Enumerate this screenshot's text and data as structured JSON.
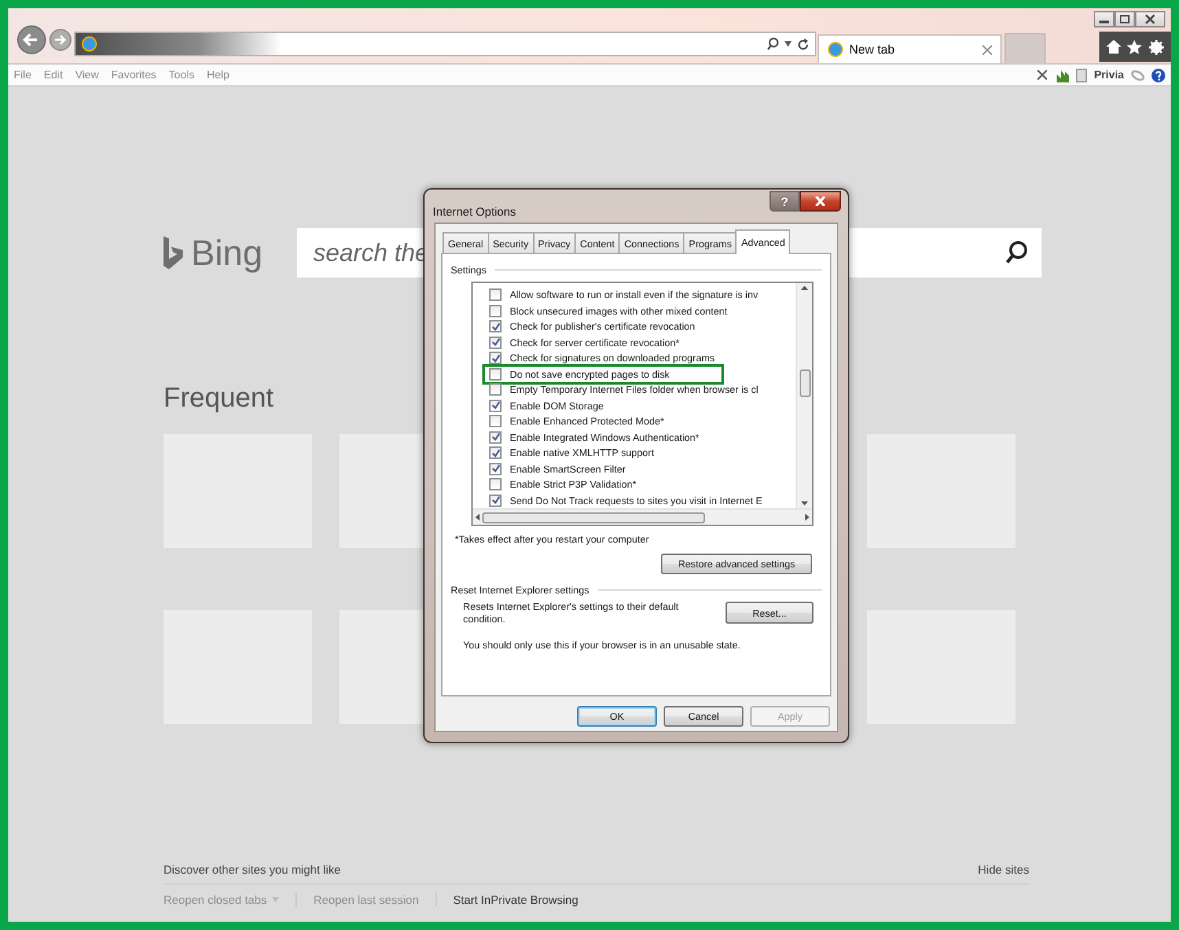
{
  "browser": {
    "tab": {
      "title": "New tab"
    },
    "menu": [
      "File",
      "Edit",
      "View",
      "Favorites",
      "Tools",
      "Help"
    ],
    "account": "Privia"
  },
  "page": {
    "logo": "Bing",
    "search": {
      "placeholder": "search the"
    },
    "section_title": "Frequent",
    "discover": "Discover other sites you might like",
    "hide_sites": "Hide sites",
    "links": [
      {
        "label": "Reopen closed tabs",
        "disabled": true,
        "has_menu": true
      },
      {
        "label": "Reopen last session",
        "disabled": true,
        "has_menu": false
      },
      {
        "label": "Start InPrivate Browsing",
        "disabled": false,
        "has_menu": false
      }
    ]
  },
  "dialog": {
    "title": "Internet Options",
    "help_label": "?",
    "tabs": [
      {
        "label": "General",
        "selected": false
      },
      {
        "label": "Security",
        "selected": false
      },
      {
        "label": "Privacy",
        "selected": false
      },
      {
        "label": "Content",
        "selected": false
      },
      {
        "label": "Connections",
        "selected": false
      },
      {
        "label": "Programs",
        "selected": false
      },
      {
        "label": "Advanced",
        "selected": true
      }
    ],
    "settings_label": "Settings",
    "settings": [
      {
        "label": "Allow software to run or install even if the signature is inv",
        "checked": false,
        "highlighted": false
      },
      {
        "label": "Block unsecured images with other mixed content",
        "checked": false,
        "highlighted": false
      },
      {
        "label": "Check for publisher's certificate revocation",
        "checked": true,
        "highlighted": false
      },
      {
        "label": "Check for server certificate revocation*",
        "checked": true,
        "highlighted": false
      },
      {
        "label": "Check for signatures on downloaded programs",
        "checked": true,
        "highlighted": false
      },
      {
        "label": "Do not save encrypted pages to disk",
        "checked": false,
        "highlighted": true
      },
      {
        "label": "Empty Temporary Internet Files folder when browser is cl",
        "checked": false,
        "highlighted": false
      },
      {
        "label": "Enable DOM Storage",
        "checked": true,
        "highlighted": false
      },
      {
        "label": "Enable Enhanced Protected Mode*",
        "checked": false,
        "highlighted": false
      },
      {
        "label": "Enable Integrated Windows Authentication*",
        "checked": true,
        "highlighted": false
      },
      {
        "label": "Enable native XMLHTTP support",
        "checked": true,
        "highlighted": false
      },
      {
        "label": "Enable SmartScreen Filter",
        "checked": true,
        "highlighted": false
      },
      {
        "label": "Enable Strict P3P Validation*",
        "checked": false,
        "highlighted": false
      },
      {
        "label": "Send Do Not Track requests to sites you visit in Internet E",
        "checked": true,
        "highlighted": false
      }
    ],
    "footnote": "*Takes effect after you restart your computer",
    "restore_button": "Restore advanced settings",
    "reset_group": "Reset Internet Explorer settings",
    "reset_text": "Resets Internet Explorer's settings to their default condition.",
    "reset_button": "Reset...",
    "reset_note": "You should only use this if your browser is in an unusable state.",
    "buttons": [
      {
        "label": "OK",
        "default": true,
        "disabled": false
      },
      {
        "label": "Cancel",
        "default": false,
        "disabled": false
      },
      {
        "label": "Apply",
        "default": false,
        "disabled": true
      }
    ]
  }
}
